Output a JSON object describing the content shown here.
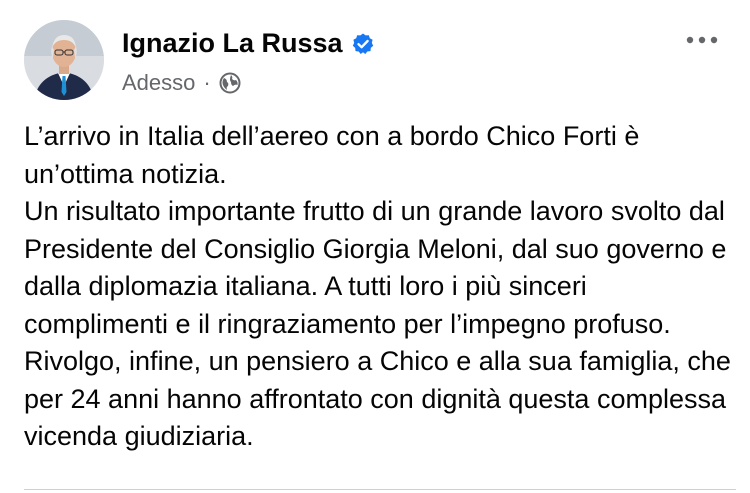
{
  "post": {
    "author": "Ignazio La Russa",
    "verified": true,
    "timestamp": "Adesso",
    "separator": "·",
    "audience_icon": "globe-icon",
    "more_icon": "more-dots-icon",
    "paragraphs": [
      "L’arrivo in Italia dell’aereo con a bordo Chico Forti è un’ottima notizia.",
      "Un risultato importante frutto di un grande lavoro svolto dal Presidente del Consiglio Giorgia Meloni, dal suo governo e dalla diplomazia italiana. A tutti loro i più sinceri complimenti e il ringraziamento per l’impegno profuso.",
      "Rivolgo, infine, un pensiero a Chico e alla sua famiglia, che per 24 anni hanno affrontato con dignità questa complessa vicenda giudiziaria."
    ]
  },
  "colors": {
    "verified_badge": "#1877f2",
    "secondary_text": "#65676b",
    "primary_text": "#050505"
  }
}
